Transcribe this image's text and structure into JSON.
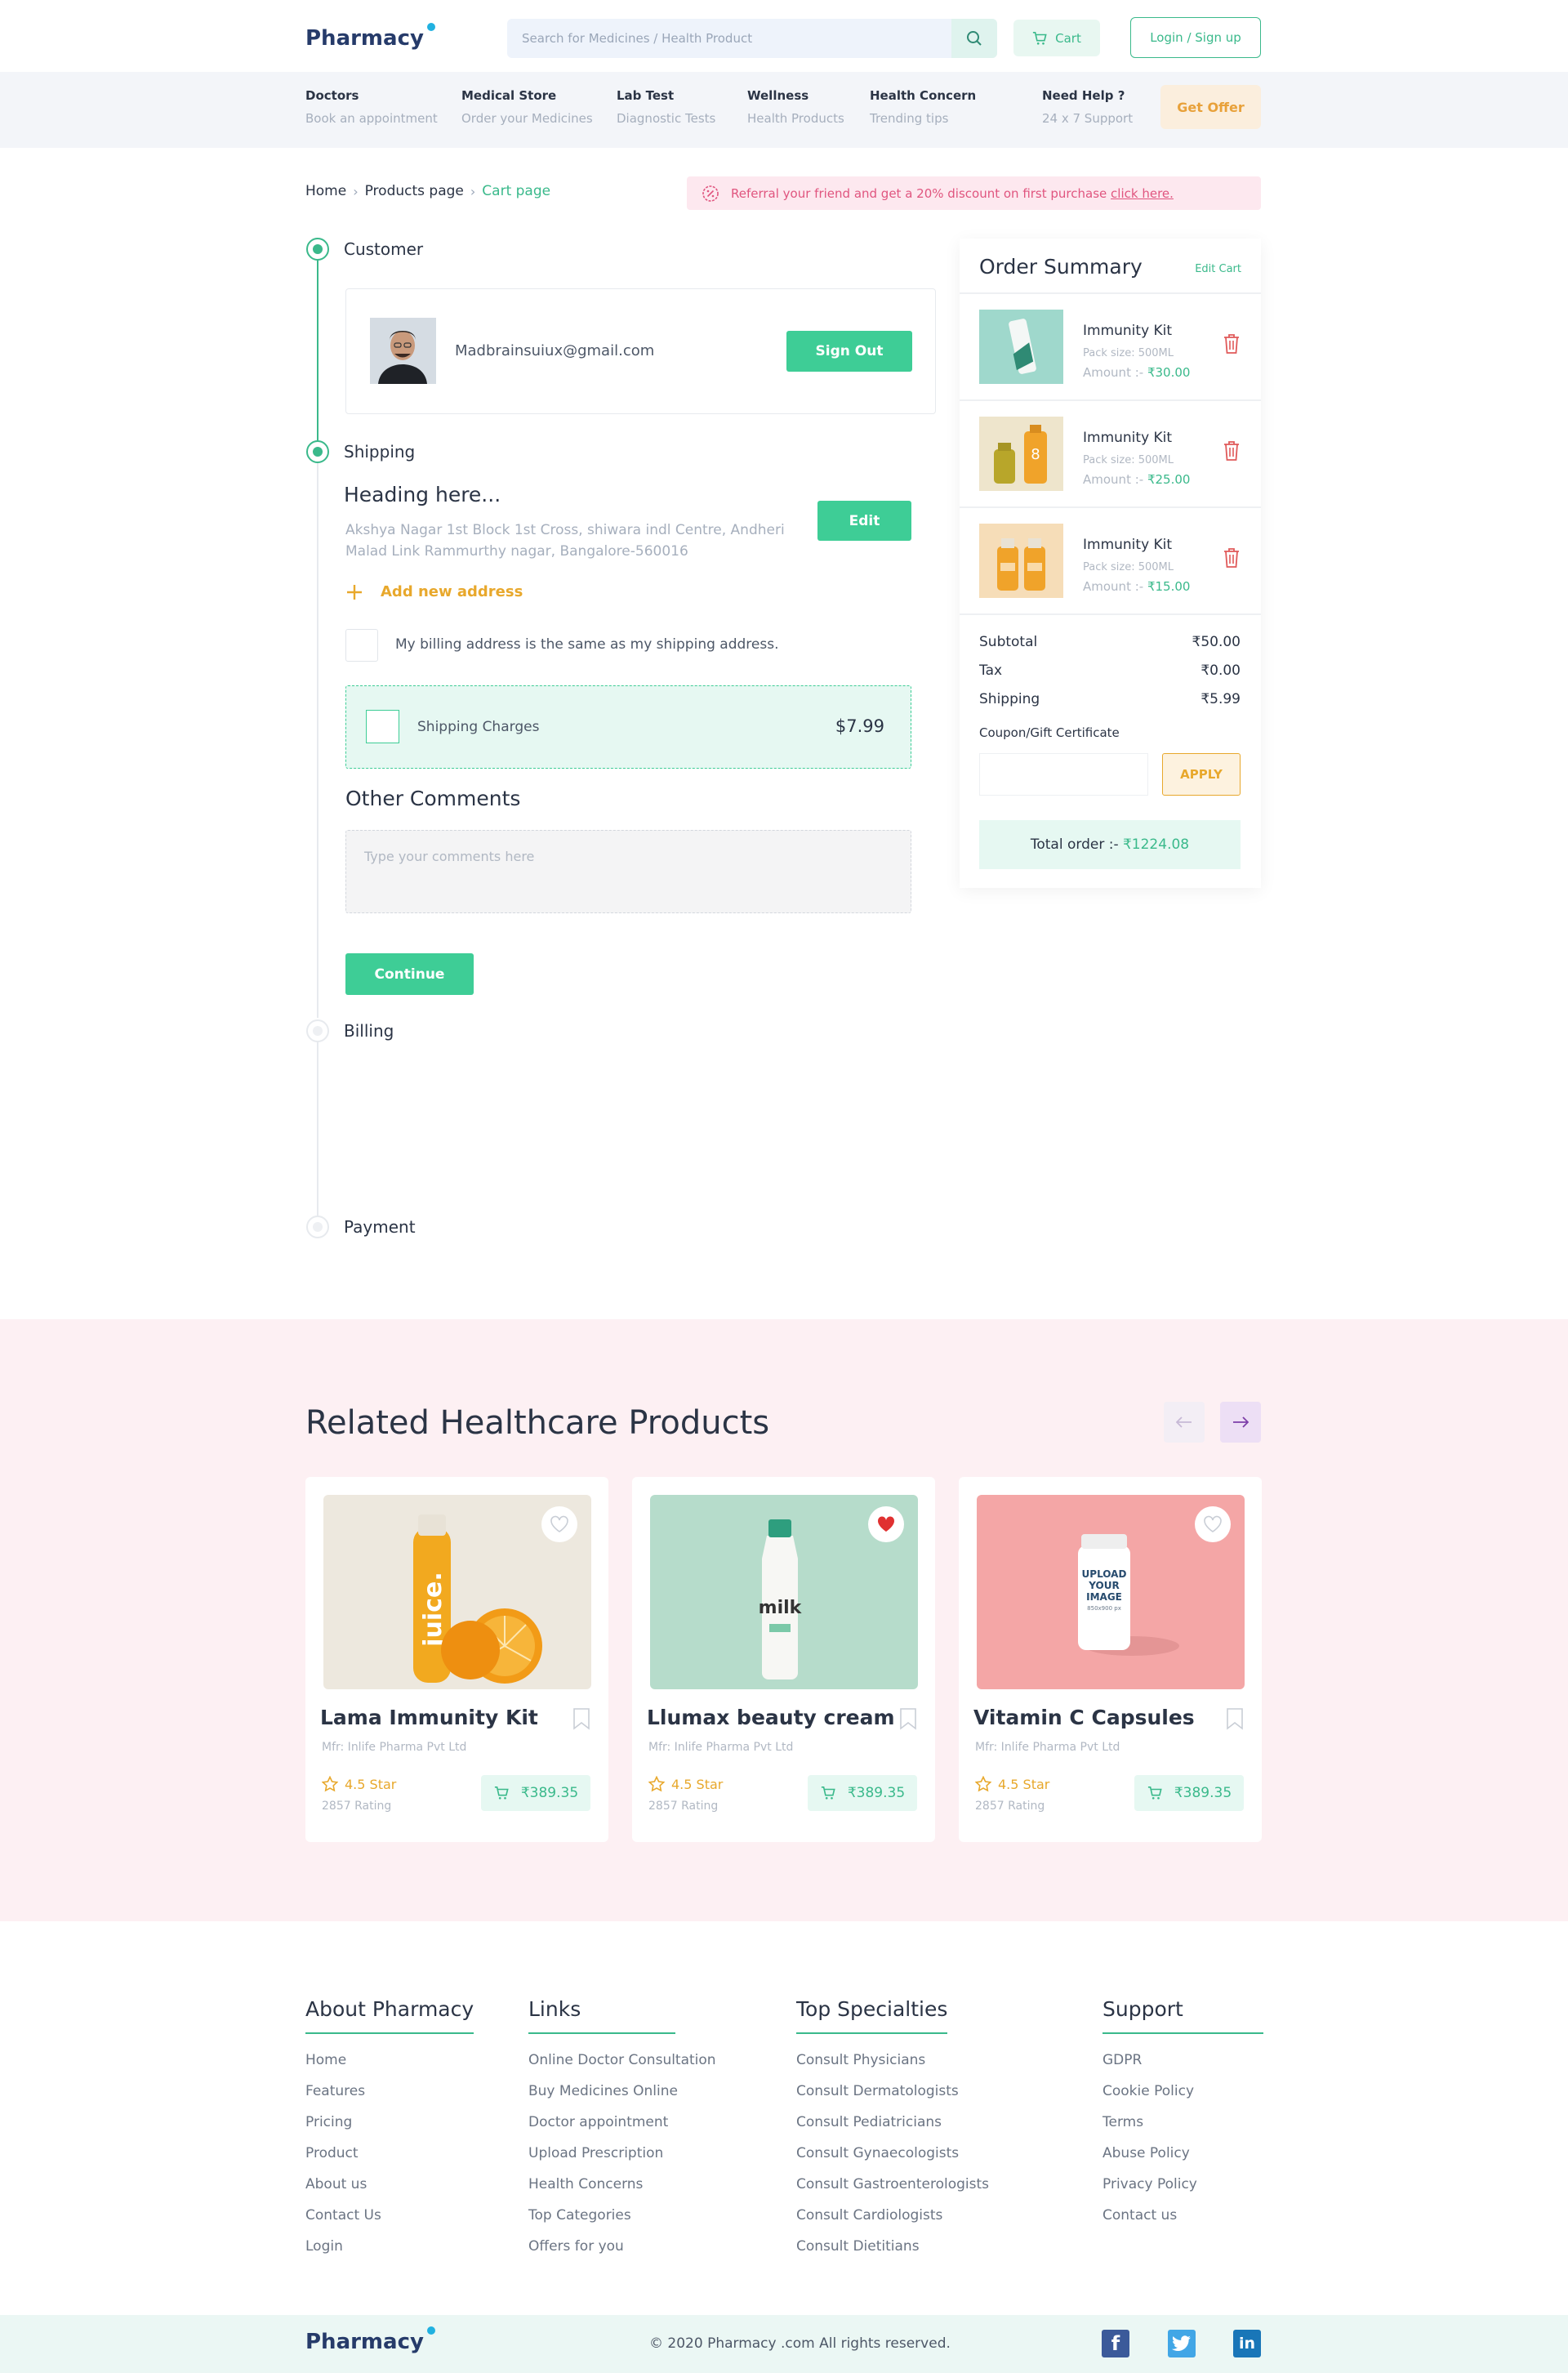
{
  "brand": {
    "name": "Pharmacy"
  },
  "header": {
    "search_placeholder": "Search for Medicines / Health Product",
    "cart_label": "Cart",
    "login_label": "Login / Sign up"
  },
  "nav": {
    "items": [
      {
        "title": "Doctors",
        "sub": "Book an appointment"
      },
      {
        "title": "Medical Store",
        "sub": "Order your Medicines"
      },
      {
        "title": "Lab Test",
        "sub": "Diagnostic Tests"
      },
      {
        "title": "Wellness",
        "sub": "Health Products"
      },
      {
        "title": "Health Concern",
        "sub": "Trending tips"
      },
      {
        "title": "Need Help ?",
        "sub": "24 x 7 Support"
      }
    ],
    "offer_label": "Get Offer"
  },
  "breadcrumb": {
    "items": [
      "Home",
      "Products page",
      "Cart page"
    ]
  },
  "referral": {
    "text": "Referral your friend and get a 20% discount on first purchase",
    "link": "click here."
  },
  "steps": {
    "customer": "Customer",
    "shipping": "Shipping",
    "billing": "Billing",
    "payment": "Payment"
  },
  "customer": {
    "email": "Madbrainsuiux@gmail.com",
    "signout_label": "Sign Out"
  },
  "shipping": {
    "heading": "Heading here...",
    "address": "Akshya Nagar 1st Block 1st Cross, shiwara indl Centre, Andheri Malad Link Rammurthy nagar, Bangalore-560016",
    "edit_label": "Edit",
    "add_new_label": "Add new address",
    "billing_same_label": "My billing address is the same as my shipping address.",
    "charges_label": "Shipping Charges",
    "charges_value": "$7.99",
    "other_comments_title": "Other Comments",
    "comments_placeholder": "Type your comments here",
    "continue_label": "Continue"
  },
  "summary": {
    "title": "Order Summary",
    "edit_label": "Edit Cart",
    "items": [
      {
        "name": "Immunity Kit",
        "pack": "Pack size: 500ML",
        "amount_label": "Amount :-",
        "amount": "₹30.00"
      },
      {
        "name": "Immunity Kit",
        "pack": "Pack size: 500ML",
        "amount_label": "Amount :-",
        "amount": "₹25.00"
      },
      {
        "name": "Immunity Kit",
        "pack": "Pack size: 500ML",
        "amount_label": "Amount :-",
        "amount": "₹15.00"
      }
    ],
    "subtotal_label": "Subtotal",
    "subtotal": "₹50.00",
    "tax_label": "Tax",
    "tax": "₹0.00",
    "shipping_label": "Shipping",
    "shipping": "₹5.99",
    "coupon_label": "Coupon/Gift Certificate",
    "apply_label": "APPLY",
    "total_label": "Total order :-",
    "total": "₹1224.08"
  },
  "related": {
    "title": "Related Healthcare Products",
    "products": [
      {
        "name": "Lama Immunity Kit",
        "mfr": "Mfr: Inlife Pharma Pvt Ltd",
        "rating": "4.5 Star",
        "rating_count": "2857 Rating",
        "price": "₹389.35",
        "img_text": "juice.",
        "favorite": false
      },
      {
        "name": "Llumax beauty cream",
        "mfr": "Mfr: Inlife Pharma Pvt Ltd",
        "rating": "4.5 Star",
        "rating_count": "2857 Rating",
        "price": "₹389.35",
        "img_text": "milk",
        "favorite": true
      },
      {
        "name": "Vitamin C Capsules",
        "mfr": "Mfr: Inlife Pharma Pvt Ltd",
        "rating": "4.5 Star",
        "rating_count": "2857 Rating",
        "price": "₹389.35",
        "img_text": "UPLOAD YOUR IMAGE",
        "img_subtext": "850x900 px",
        "favorite": false
      }
    ]
  },
  "footer": {
    "about": {
      "title": "About Pharmacy",
      "links": [
        "Home",
        "Features",
        "Pricing",
        "Product",
        "About us",
        "Contact Us",
        "Login"
      ]
    },
    "links": {
      "title": "Links",
      "links": [
        "Online Doctor Consultation",
        "Buy Medicines Online",
        "Doctor appointment",
        "Upload Prescription",
        "Health Concerns",
        "Top Categories",
        "Offers for you"
      ]
    },
    "specialties": {
      "title": "Top Specialties",
      "links": [
        "Consult Physicians",
        "Consult Dermatologists",
        "Consult Pediatricians",
        "Consult Gynaecologists",
        "Consult Gastroenterologists",
        "Consult Cardiologists",
        "Consult Dietitians"
      ]
    },
    "support": {
      "title": "Support",
      "links": [
        "GDPR",
        "Cookie Policy",
        "Terms",
        "Abuse Policy",
        "Privacy Policy",
        "Contact us"
      ]
    },
    "copyright": "© 2020 Pharmacy .com All rights reserved.",
    "social": [
      "facebook-icon",
      "twitter-icon",
      "linkedin-icon"
    ]
  },
  "colors": {
    "accent": "#3ecd96",
    "brand": "#263b6a",
    "warning": "#e8a82c",
    "danger": "#e05a5a",
    "pink_bg": "#fdf0f3"
  }
}
